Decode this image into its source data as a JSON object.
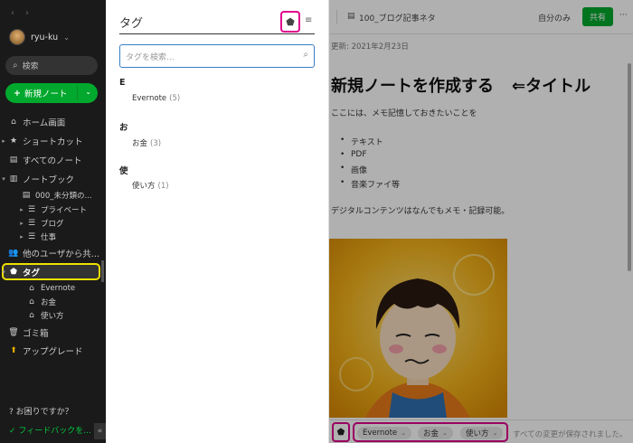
{
  "sidebar": {
    "user_name": "ryu-ku",
    "search_label": "検索",
    "new_note_label": "新規ノート",
    "nav": {
      "home": "ホーム画面",
      "shortcuts": "ショートカット",
      "all_notes": "すべてのノート",
      "notebooks": "ノートブック",
      "nb_inbox": "000_未分類の...",
      "nb_private": "プライベート",
      "nb_blog": "ブログ",
      "nb_work": "仕事",
      "shared": "他のユーザから共...",
      "tags": "タグ",
      "tag_evernote": "Evernote",
      "tag_money": "お金",
      "tag_howto": "使い方",
      "trash": "ゴミ箱",
      "upgrade": "アップグレード"
    },
    "help": "お困りですか？",
    "feedback": "フィードバックを..."
  },
  "tag_panel": {
    "title": "タグ",
    "search_placeholder": "タグを検索...",
    "groups": [
      {
        "letter": "E",
        "name": "Evernote",
        "count": "(5)"
      },
      {
        "letter": "お",
        "name": "お金",
        "count": "(3)"
      },
      {
        "letter": "使",
        "name": "使い方",
        "count": "(1)"
      }
    ]
  },
  "note": {
    "notebook": "100_ブログ記事ネタ",
    "visibility": "自分のみ",
    "share_label": "共有",
    "more_label": "···",
    "updated": "更新: 2021年2月23日",
    "title": "新規ノートを作成する",
    "title_annotation": "⇐タイトル",
    "line1": "ここには、メモ記憶しておきたいことを",
    "bullets": [
      "テキスト",
      "PDF",
      "画像",
      "音楽ファイ等"
    ],
    "line2": "デジタルコンテンツはなんでもメモ・記録可能。",
    "tags": [
      "Evernote",
      "お金",
      "使い方"
    ],
    "save_status": "すべての変更が保存されました。"
  },
  "colors": {
    "accent_green": "#00a82d",
    "highlight_magenta": "#e0008c",
    "highlight_yellow": "#f0e000",
    "sidebar_bg": "#1a1a1a"
  }
}
